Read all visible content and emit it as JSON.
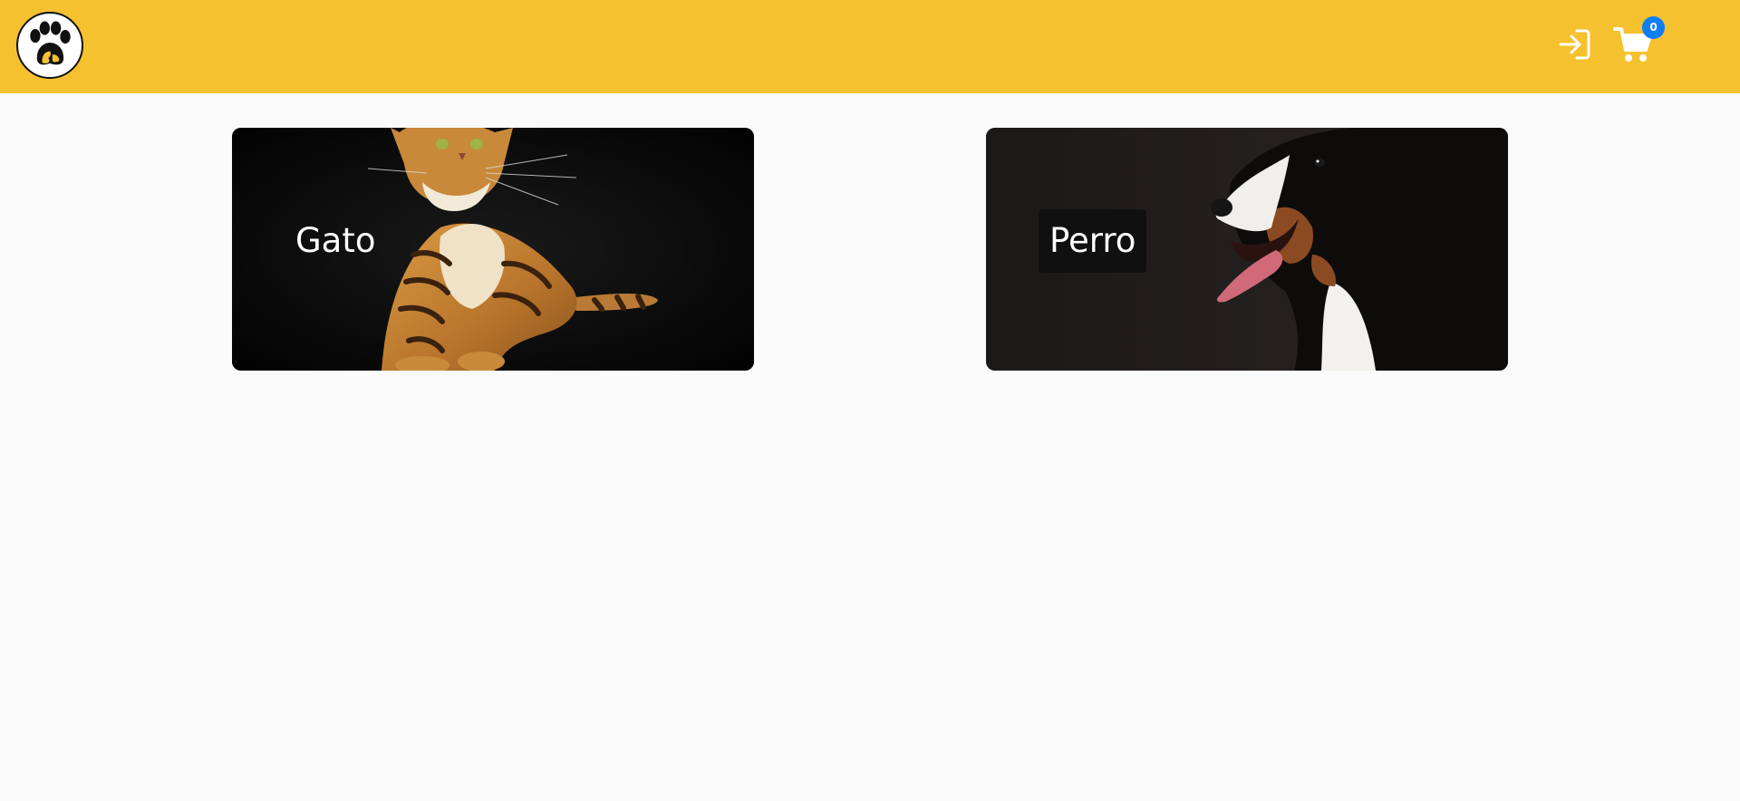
{
  "header": {
    "logo_icon": "paw-logo-icon",
    "login_icon": "login-icon",
    "cart_icon": "shopping-cart-icon",
    "cart_count": "0",
    "background": "#f5c12f",
    "badge_color": "#0d7ef3"
  },
  "categories": [
    {
      "label": "Gato",
      "image": "cat-photo"
    },
    {
      "label": "Perro",
      "image": "dog-photo"
    }
  ]
}
